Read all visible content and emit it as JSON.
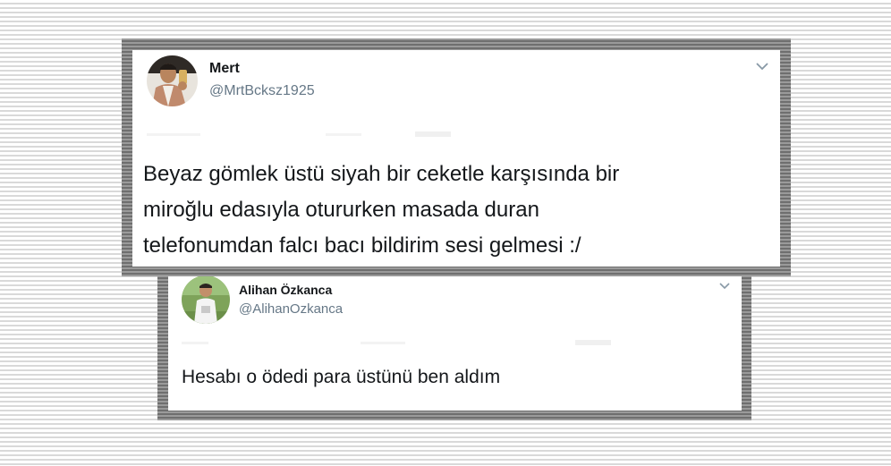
{
  "tweets": [
    {
      "name": "Mert",
      "handle": "@MrtBcksz1925",
      "text_lines": [
        "Beyaz gömlek üstü siyah bir ceketle karşısında bir",
        "miroğlu edasıyla otururken masada duran",
        "telefonumdan falcı bacı bildirim sesi gelmesi :/"
      ],
      "avatar_icon": "profile-photo-icon",
      "menu_icon": "chevron-down-icon"
    },
    {
      "name": "Alihan Özkanca",
      "handle": "@AlihanOzkanca",
      "text": "Hesabı o ödedi para üstünü ben aldım",
      "avatar_icon": "profile-photo-icon",
      "menu_icon": "chevron-down-icon"
    }
  ],
  "colors": {
    "frame": "#8d8d8d",
    "name": "#14171a",
    "handle": "#657786",
    "chevron": "#8899a6"
  }
}
